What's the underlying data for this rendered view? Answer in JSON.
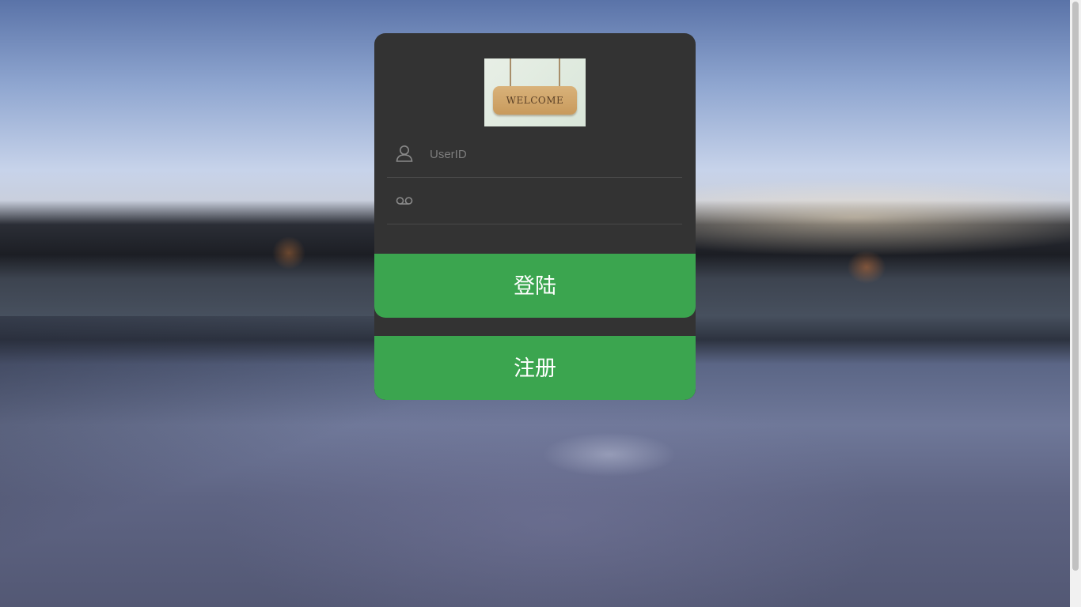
{
  "login_form": {
    "logo": {
      "text": "WELCOME",
      "icon": "welcome-sign-logo"
    },
    "userid": {
      "placeholder": "UserID",
      "value": "",
      "icon": "user-icon"
    },
    "password": {
      "placeholder": "",
      "value": "",
      "icon": "voicemail-icon"
    },
    "login_label": "登陆",
    "register_label": "注册"
  },
  "colors": {
    "panel": "#333333",
    "button": "#3ba54f",
    "button_text": "#ffffff",
    "placeholder": "#7d7d7d"
  }
}
